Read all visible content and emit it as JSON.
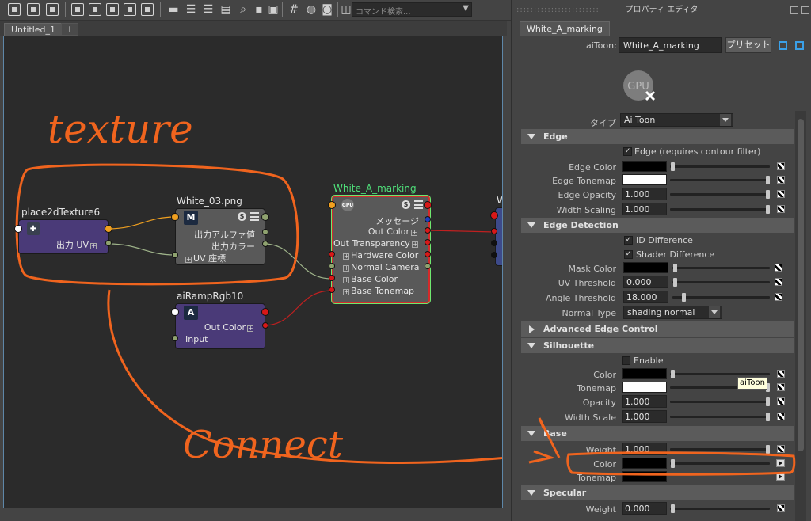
{
  "toolbar": {
    "search_placeholder": "コマンド検索..."
  },
  "editor": {
    "tab_label": "Untitled_1",
    "tab_add": "+"
  },
  "nodes": {
    "place2d": {
      "title": "place2dTexture6",
      "out_uv": "出力 UV"
    },
    "white03": {
      "title": "White_03.png",
      "icon_letter": "M",
      "out_alpha": "出力アルファ値",
      "out_color": "出力カラー",
      "uv": "UV 座標"
    },
    "ramp": {
      "title": "aiRampRgb10",
      "out_color": "Out Color",
      "input": "Input"
    },
    "toon": {
      "title": "White_A_marking",
      "message": "メッセージ",
      "out_color": "Out Color",
      "out_transparency": "Out Transparency",
      "hardware_color": "Hardware Color",
      "normal_camera": "Normal Camera",
      "base_color": "Base Color",
      "base_tonemap": "Base Tonemap"
    },
    "partial_title": "W"
  },
  "annotations": {
    "texture": "texture",
    "connect": "Connect"
  },
  "panel": {
    "header_title": "プロパティ エディタ",
    "node_tab": "White_A_marking",
    "node_type_label": "aiToon:",
    "node_name": "White_A_marking",
    "preset_button": "プリセット",
    "gpu_text": "GPU",
    "type_label": "タイプ",
    "type_value": "Ai Toon",
    "tooltip": "aiToon",
    "sections": {
      "edge": "Edge",
      "edge_detection": "Edge Detection",
      "advanced_edge": "Advanced Edge Control",
      "silhouette": "Silhouette",
      "base": "Base",
      "specular": "Specular"
    },
    "edge": {
      "enable_label": "Edge (requires contour filter)",
      "edge_color": "Edge Color",
      "edge_tonemap": "Edge Tonemap",
      "edge_opacity": "Edge Opacity",
      "edge_opacity_value": "1.000",
      "width_scaling": "Width Scaling",
      "width_scaling_value": "1.000"
    },
    "edge_detection": {
      "id_difference": "ID Difference",
      "shader_difference": "Shader Difference",
      "mask_color": "Mask Color",
      "uv_threshold": "UV Threshold",
      "uv_threshold_value": "0.000",
      "angle_threshold": "Angle Threshold",
      "angle_threshold_value": "18.000",
      "normal_type": "Normal Type",
      "normal_type_value": "shading normal"
    },
    "silhouette": {
      "enable": "Enable",
      "color": "Color",
      "tonemap": "Tonemap",
      "opacity": "Opacity",
      "opacity_value": "1.000",
      "width_scale": "Width Scale",
      "width_scale_value": "1.000"
    },
    "base": {
      "weight": "Weight",
      "weight_value": "1.000",
      "color": "Color",
      "tonemap": "Tonemap"
    },
    "specular": {
      "weight": "Weight",
      "weight_value": "0.000"
    }
  },
  "colors": {
    "accent_annotation": "#f0641e",
    "node_purple": "#4a3a78",
    "node_gray": "#595959",
    "selected_outline": "#d42a2a",
    "port_orange": "#f0a020",
    "port_red": "#d81818"
  },
  "icons": [
    "toolbar-icons",
    "gpu-x-icon",
    "texture-icon",
    "ramp-icon",
    "checker-map-button",
    "map-arrow-button",
    "triangle-collapse-icon"
  ]
}
